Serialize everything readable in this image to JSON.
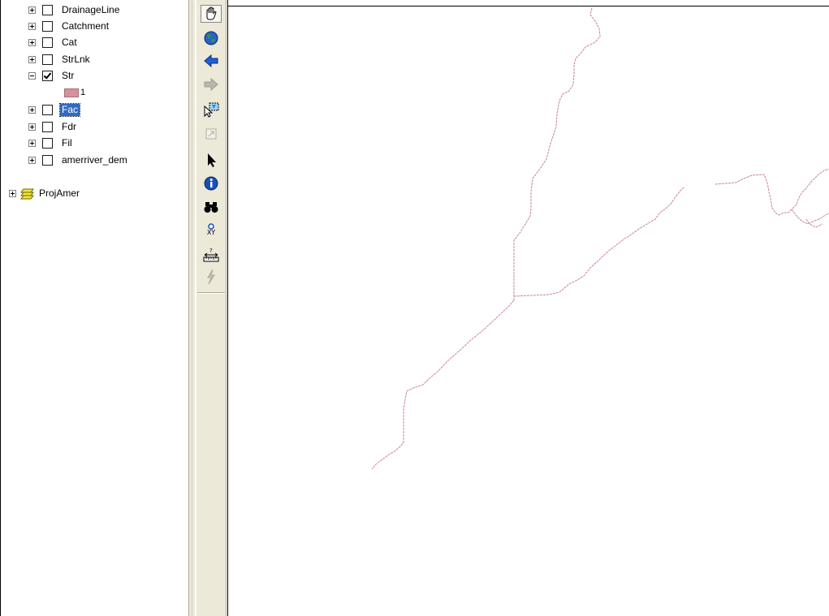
{
  "toc": {
    "layers": [
      {
        "label": "DrainageLine",
        "checked": false,
        "expanded": false
      },
      {
        "label": "Catchment",
        "checked": false,
        "expanded": false
      },
      {
        "label": "Cat",
        "checked": false,
        "expanded": false
      },
      {
        "label": "StrLnk",
        "checked": false,
        "expanded": false
      },
      {
        "label": "Str",
        "checked": true,
        "expanded": true
      },
      {
        "label": "Fac",
        "checked": false,
        "expanded": false,
        "selected": true
      },
      {
        "label": "Fdr",
        "checked": false,
        "expanded": false
      },
      {
        "label": "Fil",
        "checked": false,
        "expanded": false
      },
      {
        "label": "amerriver_dem",
        "checked": false,
        "expanded": false
      }
    ],
    "legend_item": {
      "label": "1",
      "color": "#d8909a"
    },
    "group": {
      "label": "ProjAmer",
      "expanded": false
    }
  },
  "toolbar": {
    "tools": [
      {
        "name": "pan-icon",
        "state": "active"
      },
      {
        "name": "full-extent-icon",
        "state": "enabled"
      },
      {
        "name": "back-icon",
        "state": "enabled"
      },
      {
        "name": "forward-icon",
        "state": "disabled"
      },
      {
        "name": "select-features-icon",
        "state": "enabled"
      },
      {
        "name": "clear-selection-icon",
        "state": "disabled"
      },
      {
        "name": "select-elements-icon",
        "state": "enabled"
      },
      {
        "name": "identify-icon",
        "state": "enabled"
      },
      {
        "name": "find-icon",
        "state": "enabled"
      },
      {
        "name": "go-to-xy-icon",
        "state": "enabled",
        "label": "XY"
      },
      {
        "name": "measure-icon",
        "state": "enabled"
      },
      {
        "name": "hyperlink-icon",
        "state": "disabled"
      }
    ]
  },
  "map": {
    "stream_color": "#c8848e",
    "background": "#ffffff"
  }
}
